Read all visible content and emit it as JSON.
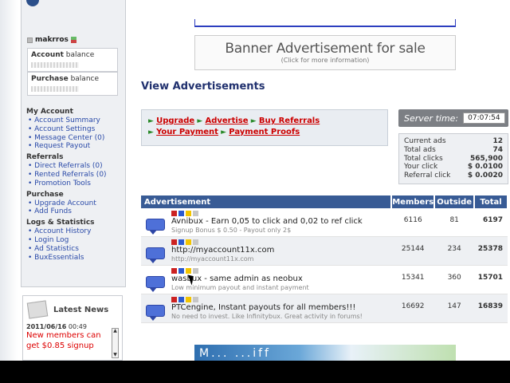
{
  "user": {
    "name": "makrros"
  },
  "balances": [
    {
      "label_bold": "Account",
      "label_rest": " balance"
    },
    {
      "label_bold": "Purchase",
      "label_rest": " balance"
    }
  ],
  "menu": {
    "sections": [
      {
        "title": "My Account",
        "items": [
          "Account Summary",
          "Account Settings",
          "Message Center (0)",
          "Request Payout"
        ]
      },
      {
        "title": "Referrals",
        "items": [
          "Direct Referrals (0)",
          "Rented Referrals (0)",
          "Promotion Tools"
        ]
      },
      {
        "title": "Purchase",
        "items": [
          "Upgrade Account",
          "Add Funds"
        ]
      },
      {
        "title": "Logs & Statistics",
        "items": [
          "Account History",
          "Login Log",
          "Ad Statistics",
          "BuxEssentials"
        ]
      }
    ]
  },
  "news": {
    "title": "Latest News",
    "date": "2011/06/16",
    "time": "00:49",
    "text": "New members can get $0.85 signup"
  },
  "banner": {
    "title": "Banner Advertisement for sale",
    "subtitle": "(Click for more information)"
  },
  "page_title": "View Advertisements",
  "quick_links": [
    "Upgrade",
    "Advertise",
    "Buy Referrals",
    "Your Payment",
    "Payment Proofs"
  ],
  "server_time": {
    "label": "Server time:",
    "value": "07:07:54"
  },
  "stats": [
    {
      "label": "Current ads",
      "value": "12"
    },
    {
      "label": "Total ads",
      "value": "74"
    },
    {
      "label": "Total clicks",
      "value": "565,900"
    },
    {
      "label": "Your click",
      "value": "$ 0.0100"
    },
    {
      "label": "Referral click",
      "value": "$ 0.0020"
    }
  ],
  "ads_table": {
    "headers": [
      "Advertisement",
      "Members",
      "Outside",
      "Total"
    ],
    "rows": [
      {
        "title": "Avnibux - Earn 0,05 to click and 0,02 to ref click",
        "sub": "Signup Bonus $ 0.50 - Payout only 2$",
        "members": "6116",
        "outside": "81",
        "total": "6197"
      },
      {
        "title": "http://myaccount11x.com",
        "sub": "http://myaccount11x.com",
        "members": "25144",
        "outside": "234",
        "total": "25378"
      },
      {
        "title": "wasbux - same admin as neobux",
        "sub": "Low minimum payout and instant payment",
        "members": "15341",
        "outside": "360",
        "total": "15701"
      },
      {
        "title": "PTCengine, Instant payouts for all members!!!",
        "sub": "No need to invest. Like Infinitybux. Great activity in forums!",
        "members": "16692",
        "outside": "147",
        "total": "16839"
      }
    ]
  },
  "bottom_banner_text": "M... ...iff"
}
